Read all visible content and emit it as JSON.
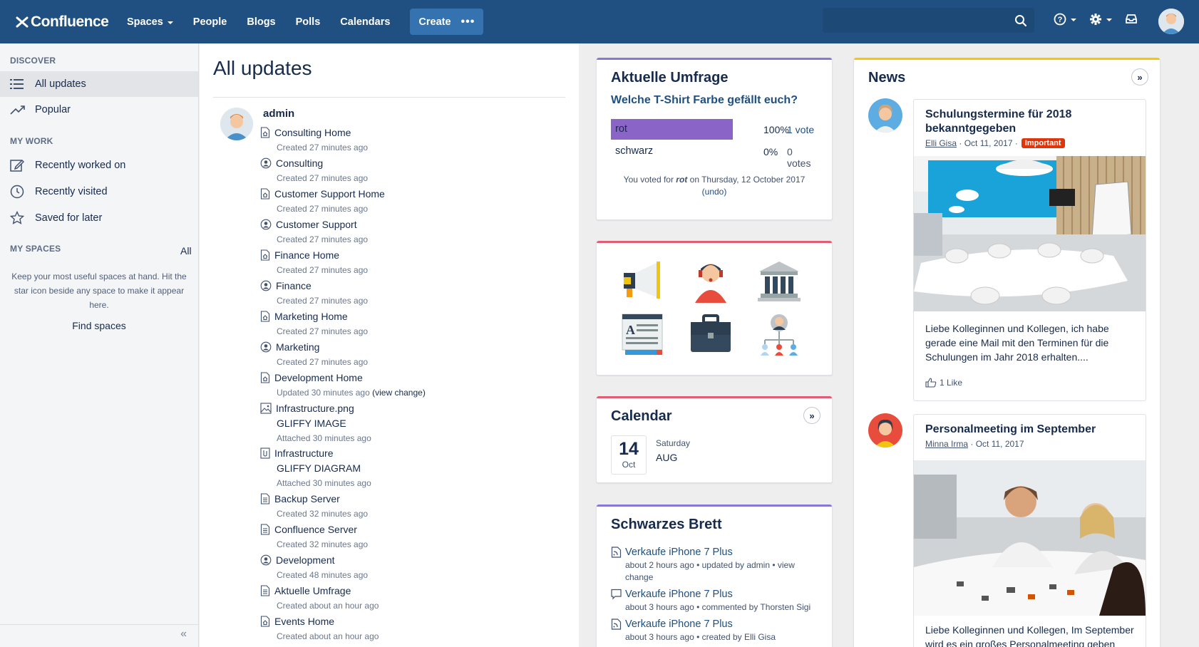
{
  "app": {
    "logo": "Confluence"
  },
  "nav": {
    "spaces": "Spaces",
    "people": "People",
    "blogs": "Blogs",
    "polls": "Polls",
    "calendars": "Calendars",
    "create": "Create",
    "more": "•••"
  },
  "search": {
    "placeholder": ""
  },
  "icons": {
    "help": "help-icon",
    "settings": "gear-icon",
    "notifications": "inbox-icon",
    "search": "search-icon"
  },
  "sidebar": {
    "discover_heading": "DISCOVER",
    "all_updates": "All updates",
    "popular": "Popular",
    "my_work_heading": "MY WORK",
    "recently_worked": "Recently worked on",
    "recently_visited": "Recently visited",
    "saved": "Saved for later",
    "my_spaces_heading": "MY SPACES",
    "all_link": "All",
    "hint": "Keep your most useful spaces at hand. Hit the star icon beside any space to make it appear here.",
    "find_spaces": "Find spaces",
    "collapse": "«"
  },
  "main": {
    "title": "All updates",
    "user": "admin",
    "items": [
      {
        "icon": "home",
        "title": "Consulting Home",
        "meta": "Created 27 minutes ago"
      },
      {
        "icon": "space",
        "title": "Consulting",
        "meta": "Created 27 minutes ago"
      },
      {
        "icon": "home",
        "title": "Customer Support Home",
        "meta": "Created 27 minutes ago"
      },
      {
        "icon": "space",
        "title": "Customer Support",
        "meta": "Created 27 minutes ago"
      },
      {
        "icon": "home",
        "title": "Finance Home",
        "meta": "Created 27 minutes ago"
      },
      {
        "icon": "space",
        "title": "Finance",
        "meta": "Created 27 minutes ago"
      },
      {
        "icon": "home",
        "title": "Marketing Home",
        "meta": "Created 27 minutes ago"
      },
      {
        "icon": "space",
        "title": "Marketing",
        "meta": "Created 27 minutes ago"
      },
      {
        "icon": "home",
        "title": "Development Home",
        "meta": "Updated 30 minutes ago",
        "extra": "(view change)"
      },
      {
        "icon": "image",
        "title": "Infrastructure.png",
        "subtitle": "GLIFFY IMAGE",
        "meta": "Attached 30 minutes ago"
      },
      {
        "icon": "attach",
        "title": "Infrastructure",
        "subtitle": "GLIFFY DIAGRAM",
        "meta": "Attached 30 minutes ago"
      },
      {
        "icon": "page",
        "title": "Backup Server",
        "meta": "Created 32 minutes ago"
      },
      {
        "icon": "page",
        "title": "Confluence Server",
        "meta": "Created 32 minutes ago"
      },
      {
        "icon": "space",
        "title": "Development",
        "meta": "Created 48 minutes ago"
      },
      {
        "icon": "page",
        "title": "Aktuelle Umfrage",
        "meta": "Created about an hour ago"
      },
      {
        "icon": "home",
        "title": "Events Home",
        "meta": "Created about an hour ago"
      }
    ]
  },
  "poll": {
    "heading": "Aktuelle Umfrage",
    "question": "Welche T-Shirt Farbe gefällt euch?",
    "options": [
      {
        "label": "rot",
        "percent": "100%",
        "votes": "1 vote",
        "fraction": 1.0
      },
      {
        "label": "schwarz",
        "percent": "0%",
        "votes": "0 votes",
        "fraction": 0
      }
    ],
    "note_prefix": "You voted for",
    "note_choice": "rot",
    "note_suffix": "on Thursday, 12 October 2017",
    "undo": "(undo)",
    "accent": "#8777d9"
  },
  "shortcuts": {
    "accent": "#e25c73",
    "icons": [
      "megaphone-icon",
      "support-agent-icon",
      "bank-icon",
      "document-icon",
      "briefcase-icon",
      "org-chart-icon"
    ]
  },
  "calendar": {
    "heading": "Calendar",
    "day": "14",
    "month": "Oct",
    "weekday": "Saturday",
    "event": "AUG",
    "accent": "#e25c73",
    "expand": "»"
  },
  "board": {
    "heading": "Schwarzes Brett",
    "accent": "#8777d9",
    "entries": [
      {
        "icon": "blog",
        "title": "Verkaufe iPhone 7 Plus",
        "meta": "about 2 hours ago • updated by admin • view change"
      },
      {
        "icon": "comment",
        "title": "Verkaufe iPhone 7 Plus",
        "meta": "about 3 hours ago • commented by Thorsten Sigi"
      },
      {
        "icon": "blog",
        "title": "Verkaufe iPhone 7 Plus",
        "meta": "about 3 hours ago • created by Elli Gisa"
      }
    ]
  },
  "news": {
    "heading": "News",
    "accent": "#ffc400",
    "expand": "»",
    "posts": [
      {
        "title": "Schulungstermine für 2018 bekanntgegeben",
        "author": "Elli Gisa",
        "date": "· Oct 11, 2017 ·",
        "badge": "Important",
        "text": "Liebe Kolleginnen und Kollegen, ich habe gerade eine Mail mit den Terminen für die Schulungen im Jahr 2018 erhalten....",
        "likes": "1 Like"
      },
      {
        "title": "Personalmeeting im September",
        "author": "Minna Irma",
        "date": "· Oct 11, 2017",
        "text": "Liebe Kolleginnen und Kollegen, Im September wird es ein großes Personalmeeting geben"
      }
    ]
  }
}
